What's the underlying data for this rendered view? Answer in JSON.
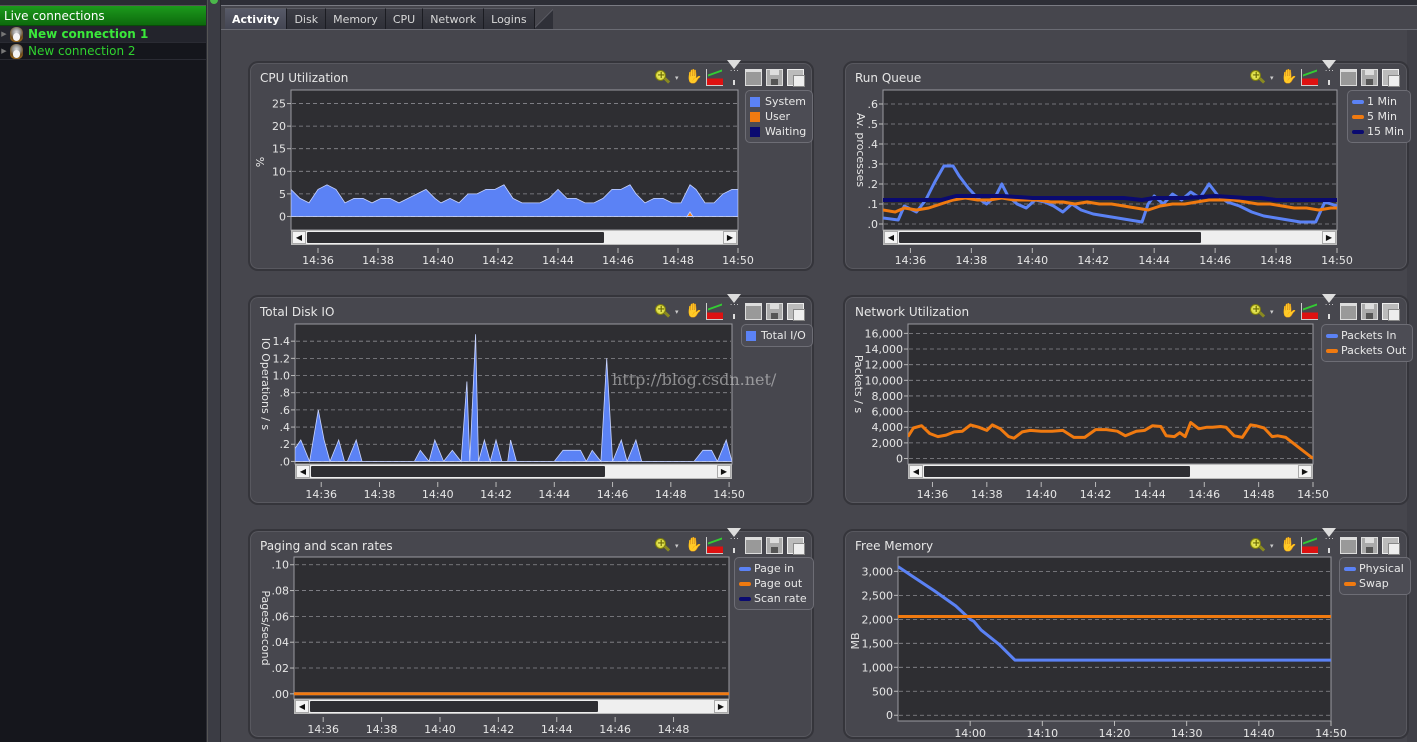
{
  "sidebar": {
    "header": "Live connections",
    "connections": [
      {
        "label": "New connection 1",
        "selected": true,
        "icon": "linux-tux-icon"
      },
      {
        "label": "New connection 2",
        "selected": false,
        "icon": "linux-tux-icon"
      }
    ]
  },
  "tabs": [
    {
      "label": "Activity",
      "active": true
    },
    {
      "label": "Disk",
      "active": false
    },
    {
      "label": "Memory",
      "active": false
    },
    {
      "label": "CPU",
      "active": false
    },
    {
      "label": "Network",
      "active": false
    },
    {
      "label": "Logins",
      "active": false
    }
  ],
  "toolbar_icons": [
    "zoom-icon",
    "dropdown-caret-icon",
    "pan-hand-icon",
    "chart-type-icon",
    "filter-icon",
    "window-icon",
    "save-icon",
    "copy-clipboard-icon"
  ],
  "watermark": "http://blog.csdn.net/",
  "colors": {
    "blue": "#5b82f5",
    "orange": "#f07a10",
    "navy": "#0a0a70",
    "sidebar_header": "#149014",
    "connection_text": "#2fd12f"
  },
  "chart_data": [
    {
      "id": "cpu",
      "title": "CPU Utilization",
      "type": "area",
      "ylabel": "%",
      "xlabel": "",
      "yticks": [
        "0",
        "5",
        "10",
        "15",
        "20",
        "25"
      ],
      "ylim": [
        -3,
        28
      ],
      "xticks": [
        "14:36",
        "14:38",
        "14:40",
        "14:42",
        "14:44",
        "14:46",
        "14:48",
        "14:50"
      ],
      "xlim_minutes": [
        35.1,
        50.0
      ],
      "grid": true,
      "legend": "top-right",
      "scroll_thumb": [
        0.0,
        0.73
      ],
      "series": [
        {
          "name": "System",
          "color": "#5b82f5",
          "style": "box",
          "x": [
            35.1,
            35.4,
            35.7,
            36.0,
            36.3,
            36.6,
            36.9,
            37.2,
            37.5,
            37.8,
            38.1,
            38.4,
            38.7,
            39.0,
            39.3,
            39.6,
            39.9,
            40.1,
            40.4,
            40.7,
            41.0,
            41.3,
            41.6,
            41.9,
            42.2,
            42.5,
            42.8,
            43.1,
            43.4,
            43.7,
            44.0,
            44.3,
            44.6,
            44.9,
            45.2,
            45.5,
            45.8,
            46.1,
            46.4,
            46.6,
            46.9,
            47.2,
            47.5,
            47.8,
            48.1,
            48.4,
            48.6,
            48.9,
            49.2,
            49.5,
            49.8,
            50.0
          ],
          "y": [
            6,
            4,
            3,
            6,
            7,
            6,
            3,
            4,
            4,
            3,
            4,
            4,
            3,
            4,
            5,
            6,
            4,
            3,
            4,
            3,
            5,
            5,
            6,
            6,
            7,
            4,
            3,
            3,
            3,
            4,
            6,
            4,
            4,
            3,
            3,
            4,
            6,
            6,
            7,
            5,
            3,
            4,
            4,
            3,
            3,
            7,
            6,
            3,
            3,
            5,
            6,
            6
          ]
        },
        {
          "name": "User",
          "color": "#f07a10",
          "style": "box",
          "x": [
            48.3,
            48.4,
            48.5
          ],
          "y": [
            0,
            1,
            0
          ]
        },
        {
          "name": "Waiting",
          "color": "#0a0a70",
          "style": "box",
          "x": [],
          "y": []
        }
      ]
    },
    {
      "id": "runqueue",
      "title": "Run Queue",
      "type": "line",
      "ylabel": "Av. processes",
      "xlabel": "",
      "yticks": [
        ".0",
        ".1",
        ".2",
        ".3",
        ".4",
        ".5",
        ".6"
      ],
      "ylim": [
        -0.03,
        0.67
      ],
      "xticks": [
        "14:36",
        "14:38",
        "14:40",
        "14:42",
        "14:44",
        "14:46",
        "14:48",
        "14:50"
      ],
      "xlim_minutes": [
        35.1,
        50.0
      ],
      "grid": true,
      "legend": "top-right",
      "scroll_thumb": [
        0.0,
        0.73
      ],
      "series": [
        {
          "name": "1 Min",
          "color": "#5b82f5",
          "style": "line",
          "x": [
            35.1,
            35.6,
            35.8,
            36.2,
            36.5,
            36.8,
            37.1,
            37.4,
            37.6,
            37.9,
            38.2,
            38.5,
            38.8,
            39.0,
            39.2,
            39.5,
            39.8,
            40.1,
            40.4,
            40.7,
            41.0,
            41.3,
            41.6,
            42.0,
            42.4,
            42.8,
            43.2,
            43.6,
            43.8,
            44.0,
            44.3,
            44.6,
            44.9,
            45.2,
            45.5,
            45.8,
            46.1,
            46.4,
            46.8,
            47.2,
            47.6,
            48.0,
            48.4,
            48.8,
            49.3,
            49.6,
            49.8,
            50.0
          ],
          "y": [
            0.03,
            0.02,
            0.09,
            0.06,
            0.12,
            0.21,
            0.29,
            0.29,
            0.24,
            0.18,
            0.13,
            0.1,
            0.14,
            0.2,
            0.14,
            0.1,
            0.08,
            0.12,
            0.11,
            0.09,
            0.06,
            0.1,
            0.07,
            0.05,
            0.04,
            0.03,
            0.02,
            0.01,
            0.1,
            0.14,
            0.1,
            0.15,
            0.12,
            0.16,
            0.13,
            0.2,
            0.14,
            0.11,
            0.09,
            0.06,
            0.04,
            0.03,
            0.02,
            0.01,
            0.01,
            0.11,
            0.1,
            0.09
          ]
        },
        {
          "name": "5 Min",
          "color": "#f07a10",
          "style": "line",
          "x": [
            35.1,
            35.5,
            35.8,
            36.2,
            36.6,
            37.0,
            37.4,
            37.8,
            38.2,
            38.6,
            39.0,
            39.4,
            39.8,
            40.2,
            40.6,
            41.0,
            41.4,
            41.8,
            42.2,
            42.6,
            43.0,
            43.4,
            43.8,
            44.2,
            44.6,
            45.0,
            45.4,
            45.8,
            46.2,
            46.6,
            47.0,
            47.4,
            47.8,
            48.2,
            48.6,
            49.0,
            49.4,
            49.8,
            50.0
          ],
          "y": [
            0.07,
            0.06,
            0.08,
            0.07,
            0.08,
            0.1,
            0.12,
            0.13,
            0.12,
            0.12,
            0.13,
            0.12,
            0.12,
            0.12,
            0.11,
            0.11,
            0.1,
            0.11,
            0.1,
            0.1,
            0.09,
            0.08,
            0.07,
            0.09,
            0.1,
            0.1,
            0.11,
            0.12,
            0.12,
            0.12,
            0.11,
            0.1,
            0.1,
            0.09,
            0.08,
            0.08,
            0.07,
            0.08,
            0.08
          ]
        },
        {
          "name": "15 Min",
          "color": "#0a0a70",
          "style": "line",
          "x": [
            35.1,
            36.0,
            37.0,
            37.5,
            38.0,
            39.0,
            40.0,
            41.0,
            42.0,
            43.0,
            43.6,
            44.0,
            45.0,
            46.0,
            47.0,
            47.5,
            48.0,
            49.0,
            50.0
          ],
          "y": [
            0.12,
            0.12,
            0.12,
            0.14,
            0.14,
            0.14,
            0.13,
            0.13,
            0.13,
            0.13,
            0.12,
            0.13,
            0.13,
            0.14,
            0.13,
            0.13,
            0.12,
            0.12,
            0.12
          ]
        }
      ]
    },
    {
      "id": "diskio",
      "title": "Total Disk IO",
      "type": "area",
      "ylabel": "IO Operations / s",
      "xlabel": "",
      "yticks": [
        ".0",
        ".2",
        ".4",
        ".6",
        ".8",
        "1.0",
        "1.2",
        "1.4"
      ],
      "ylim": [
        -0.03,
        1.6
      ],
      "xticks": [
        "14:36",
        "14:38",
        "14:40",
        "14:42",
        "14:44",
        "14:46",
        "14:48",
        "14:50"
      ],
      "xlim_minutes": [
        35.1,
        50.1
      ],
      "grid": true,
      "legend": "top-right",
      "scroll_thumb": [
        0.0,
        0.74
      ],
      "series": [
        {
          "name": "Total I/O",
          "color": "#5b82f5",
          "style": "box",
          "x": [
            35.1,
            35.3,
            35.6,
            35.9,
            36.1,
            36.3,
            36.6,
            36.8,
            36.9,
            37.2,
            37.4,
            39.2,
            39.4,
            39.7,
            39.9,
            40.2,
            40.5,
            40.8,
            41.0,
            41.1,
            41.3,
            41.4,
            41.6,
            41.8,
            42.0,
            42.2,
            42.4,
            42.5,
            42.7,
            44.0,
            44.3,
            44.9,
            45.1,
            45.3,
            45.6,
            45.8,
            46.0,
            46.3,
            46.5,
            46.8,
            47.0,
            47.3,
            47.6,
            47.9,
            48.8,
            49.1,
            49.4,
            49.6,
            49.9,
            50.1
          ],
          "y": [
            0.15,
            0.25,
            0,
            0.6,
            0.25,
            0,
            0.25,
            0,
            0,
            0.25,
            0,
            0,
            0.13,
            0,
            0.25,
            0,
            0.13,
            0,
            0.93,
            0,
            1.48,
            0,
            0.25,
            0,
            0.25,
            0,
            0,
            0.25,
            0,
            0,
            0.13,
            0.13,
            0,
            0.13,
            0,
            1.2,
            0,
            0.25,
            0,
            0.25,
            0,
            0,
            0,
            0,
            0,
            0.13,
            0.13,
            0,
            0.25,
            0
          ]
        }
      ]
    },
    {
      "id": "network",
      "title": "Network Utilization",
      "type": "line",
      "ylabel": "Packets / s",
      "xlabel": "",
      "yticks": [
        "0",
        "2,000",
        "4,000",
        "6,000",
        "8,000",
        "10,000",
        "12,000",
        "14,000",
        "16,000"
      ],
      "ylim": [
        -700,
        17200
      ],
      "xticks": [
        "14:36",
        "14:38",
        "14:40",
        "14:42",
        "14:44",
        "14:46",
        "14:48",
        "14:50"
      ],
      "xlim_minutes": [
        35.1,
        50.0
      ],
      "grid": true,
      "legend": "top-right",
      "scroll_thumb": [
        0.0,
        0.73
      ],
      "series": [
        {
          "name": "Packets In",
          "color": "#5b82f5",
          "style": "line",
          "x": [],
          "y": []
        },
        {
          "name": "Packets Out",
          "color": "#f07a10",
          "style": "line",
          "x": [
            35.1,
            35.3,
            35.6,
            35.9,
            36.2,
            36.5,
            36.8,
            37.1,
            37.4,
            37.7,
            38.0,
            38.2,
            38.5,
            38.8,
            39.0,
            39.3,
            39.6,
            40.0,
            40.4,
            40.8,
            41.2,
            41.6,
            42.0,
            42.4,
            42.8,
            43.1,
            43.5,
            43.8,
            44.1,
            44.4,
            44.6,
            44.9,
            45.1,
            45.3,
            45.5,
            45.8,
            46.1,
            46.3,
            46.6,
            46.8,
            47.1,
            47.4,
            47.7,
            47.9,
            48.2,
            48.5,
            48.7,
            49.0,
            50.0
          ],
          "y": [
            2800,
            3900,
            4200,
            3200,
            2800,
            3000,
            3400,
            3500,
            4300,
            4000,
            3600,
            4300,
            3800,
            2800,
            2600,
            3400,
            3600,
            3500,
            3500,
            3600,
            2700,
            2700,
            3700,
            3700,
            3500,
            2900,
            3500,
            3600,
            4200,
            4100,
            2900,
            2800,
            3300,
            2800,
            4600,
            3800,
            4000,
            4000,
            4100,
            4000,
            2900,
            2700,
            4300,
            4200,
            3900,
            2800,
            2900,
            2700,
            0
          ]
        }
      ]
    },
    {
      "id": "paging",
      "title": "Paging and scan rates",
      "type": "line",
      "ylabel": "Pages/second",
      "xlabel": "",
      "yticks": [
        ".00",
        ".02",
        ".04",
        ".06",
        ".08",
        ".10"
      ],
      "ylim": [
        -0.004,
        0.106
      ],
      "xticks": [
        "14:36",
        "14:38",
        "14:40",
        "14:42",
        "14:44",
        "14:46",
        "14:48"
      ],
      "xlim_minutes": [
        35.0,
        49.9
      ],
      "grid": true,
      "legend": "top-right",
      "scroll_thumb": [
        0.0,
        0.73
      ],
      "series": [
        {
          "name": "Page in",
          "color": "#5b82f5",
          "style": "line",
          "x": [
            35.0,
            49.9
          ],
          "y": [
            0,
            0
          ]
        },
        {
          "name": "Page out",
          "color": "#f07a10",
          "style": "line",
          "x": [
            35.0,
            49.9
          ],
          "y": [
            0,
            0
          ]
        },
        {
          "name": "Scan rate",
          "color": "#0a0a70",
          "style": "line",
          "x": [],
          "y": []
        }
      ]
    },
    {
      "id": "memory",
      "title": "Free Memory",
      "type": "line",
      "ylabel": "MB",
      "xlabel": "",
      "yticks": [
        "0",
        "500",
        "1,000",
        "1,500",
        "2,000",
        "2,500",
        "3,000"
      ],
      "ylim": [
        -120,
        3300
      ],
      "xticks": [
        "14:00",
        "14:10",
        "14:20",
        "14:30",
        "14:40",
        "14:50"
      ],
      "xlim_minutes": [
        -10.0,
        50.0
      ],
      "grid": true,
      "legend": "top-right",
      "scroll_thumb": null,
      "series": [
        {
          "name": "Physical",
          "color": "#5b82f5",
          "style": "line",
          "x": [
            -10.0,
            -8.0,
            -5.0,
            -2.0,
            0.0,
            0.5,
            1.5,
            4.0,
            6.2,
            20.0,
            50.0
          ],
          "y": [
            3100,
            2900,
            2600,
            2280,
            2000,
            1960,
            1780,
            1480,
            1150,
            1150,
            1150
          ]
        },
        {
          "name": "Swap",
          "color": "#f07a10",
          "style": "line",
          "x": [
            -10.0,
            50.0
          ],
          "y": [
            2060,
            2060
          ]
        }
      ]
    }
  ]
}
